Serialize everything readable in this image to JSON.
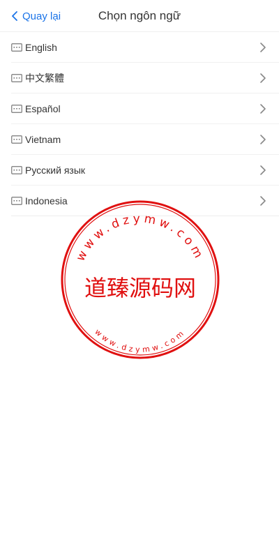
{
  "header": {
    "back_label": "Quay lại",
    "title": "Chọn ngôn ngữ"
  },
  "languages": [
    {
      "label": "English"
    },
    {
      "label": "中文繁體"
    },
    {
      "label": "Español"
    },
    {
      "label": "Vietnam"
    },
    {
      "label": "Русский язык"
    },
    {
      "label": "Indonesia"
    }
  ],
  "watermark": {
    "center_text": "道臻源码网",
    "ring_text_top": "www.dzymw.com",
    "ring_text_bottom": "www.dzymw.com",
    "color": "#e01010"
  },
  "colors": {
    "accent": "#1a73e8",
    "text": "#333333",
    "icon": "#777777"
  }
}
